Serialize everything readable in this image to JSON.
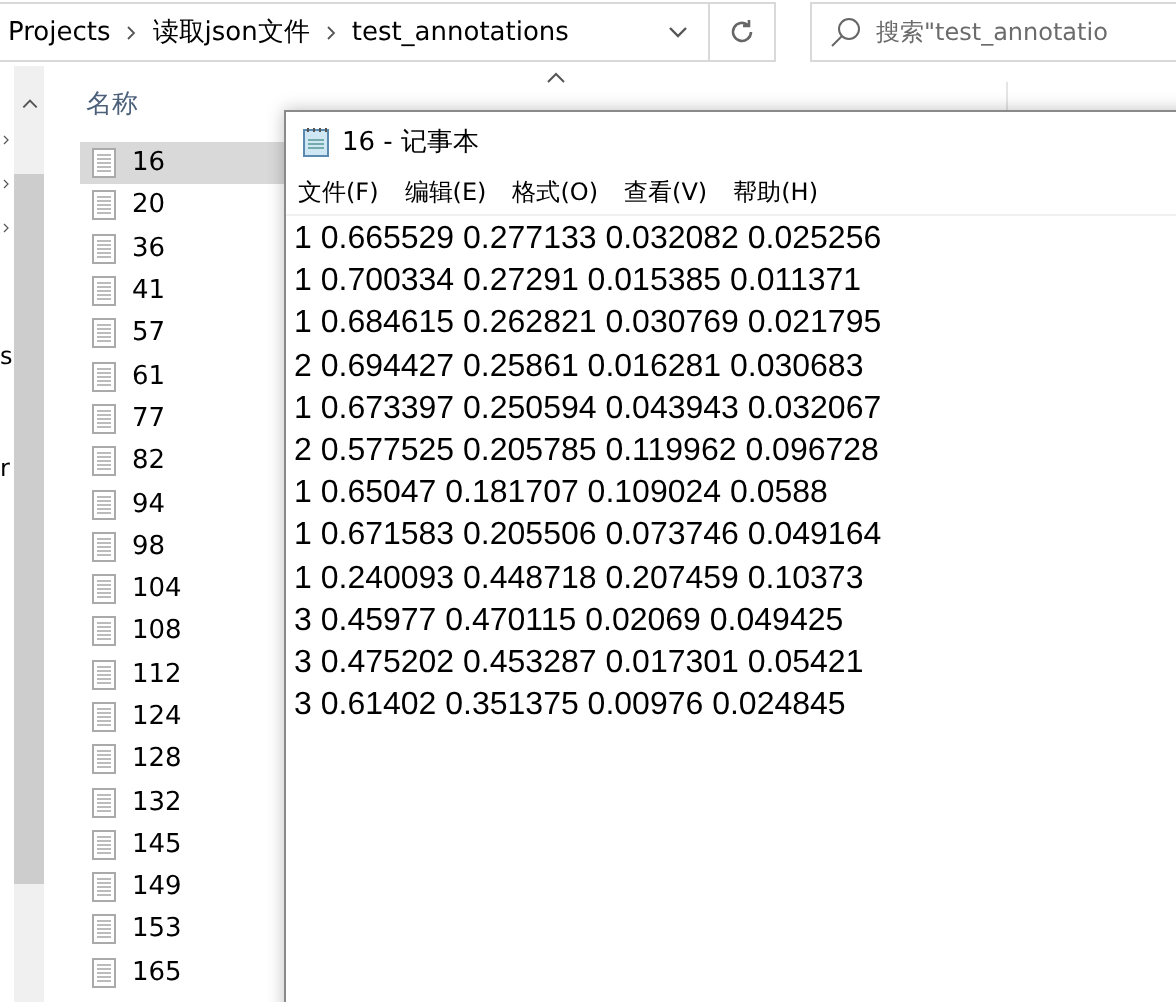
{
  "address_bar": {
    "breadcrumbs": [
      "Projects",
      "读取json文件",
      "test_annotations"
    ]
  },
  "search": {
    "placeholder": "搜索\"test_annotatio"
  },
  "nav_pane": {
    "items": [
      "s",
      "r"
    ]
  },
  "file_list": {
    "columns": [
      "名称"
    ],
    "rows": [
      {
        "name": "16",
        "selected": true
      },
      {
        "name": "20",
        "selected": false
      },
      {
        "name": "36",
        "selected": false
      },
      {
        "name": "41",
        "selected": false
      },
      {
        "name": "57",
        "selected": false
      },
      {
        "name": "61",
        "selected": false
      },
      {
        "name": "77",
        "selected": false
      },
      {
        "name": "82",
        "selected": false
      },
      {
        "name": "94",
        "selected": false
      },
      {
        "name": "98",
        "selected": false
      },
      {
        "name": "104",
        "selected": false
      },
      {
        "name": "108",
        "selected": false
      },
      {
        "name": "112",
        "selected": false
      },
      {
        "name": "124",
        "selected": false
      },
      {
        "name": "128",
        "selected": false
      },
      {
        "name": "132",
        "selected": false
      },
      {
        "name": "145",
        "selected": false
      },
      {
        "name": "149",
        "selected": false
      },
      {
        "name": "153",
        "selected": false
      },
      {
        "name": "165",
        "selected": false
      }
    ]
  },
  "notepad": {
    "title": "16 - 记事本",
    "menu": [
      "文件(F)",
      "编辑(E)",
      "格式(O)",
      "查看(V)",
      "帮助(H)"
    ],
    "lines": [
      "1 0.665529 0.277133 0.032082 0.025256",
      "1 0.700334 0.27291 0.015385 0.011371",
      "1 0.684615 0.262821 0.030769 0.021795",
      "2 0.694427 0.25861 0.016281 0.030683",
      "1 0.673397 0.250594 0.043943 0.032067",
      "2 0.577525 0.205785 0.119962 0.096728",
      "1 0.65047 0.181707 0.109024 0.0588",
      "1 0.671583 0.205506 0.073746 0.049164",
      "1 0.240093 0.448718 0.207459 0.10373",
      "3 0.45977 0.470115 0.02069 0.049425",
      "3 0.475202 0.453287 0.017301 0.05421",
      "3 0.61402 0.351375 0.00976 0.024845"
    ]
  }
}
